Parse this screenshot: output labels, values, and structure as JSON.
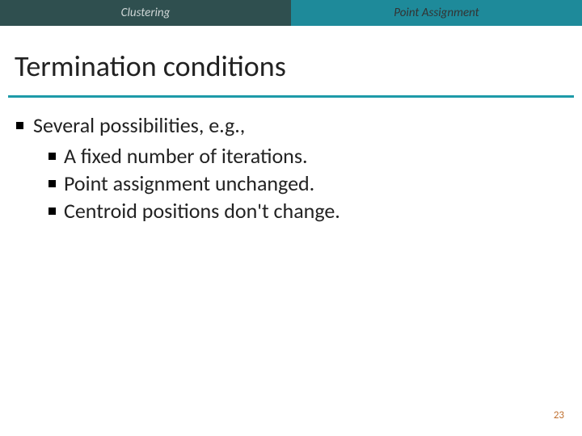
{
  "tabs": {
    "left": "Clustering",
    "right": "Point Assignment"
  },
  "title": "Termination conditions",
  "main_bullet": "Several possibilities, e.g.,",
  "sub_bullets": [
    "A fixed number of iterations.",
    "Point assignment unchanged.",
    "Centroid positions don't change."
  ],
  "page_number": "23"
}
